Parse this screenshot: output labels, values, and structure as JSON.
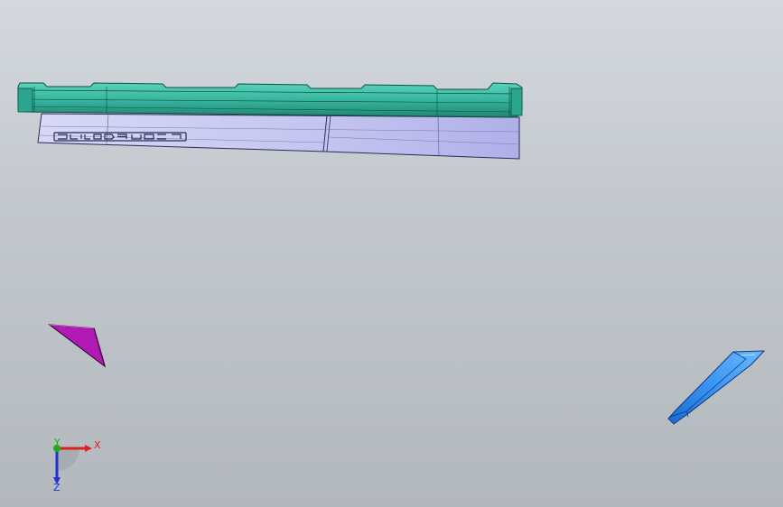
{
  "viewport": {
    "background_top": "#d4d9de",
    "background_bottom": "#b3b8bd"
  },
  "parts": [
    {
      "name": "rail",
      "color": "#3fbfa7",
      "dark": "#1f8a77"
    },
    {
      "name": "glass-panel",
      "color": "#c6c6f2",
      "edge": "#2a2a55"
    },
    {
      "name": "wedge",
      "color": "#b21ab6",
      "edge": "#3a0a3c"
    },
    {
      "name": "clip",
      "color": "#2f8ef0",
      "edge": "#0d3a80"
    }
  ],
  "triad": {
    "x_label": "X",
    "y_label": "Y",
    "z_label": "Z",
    "x_color": "#e02020",
    "y_color": "#18b018",
    "z_color": "#2030d8"
  }
}
